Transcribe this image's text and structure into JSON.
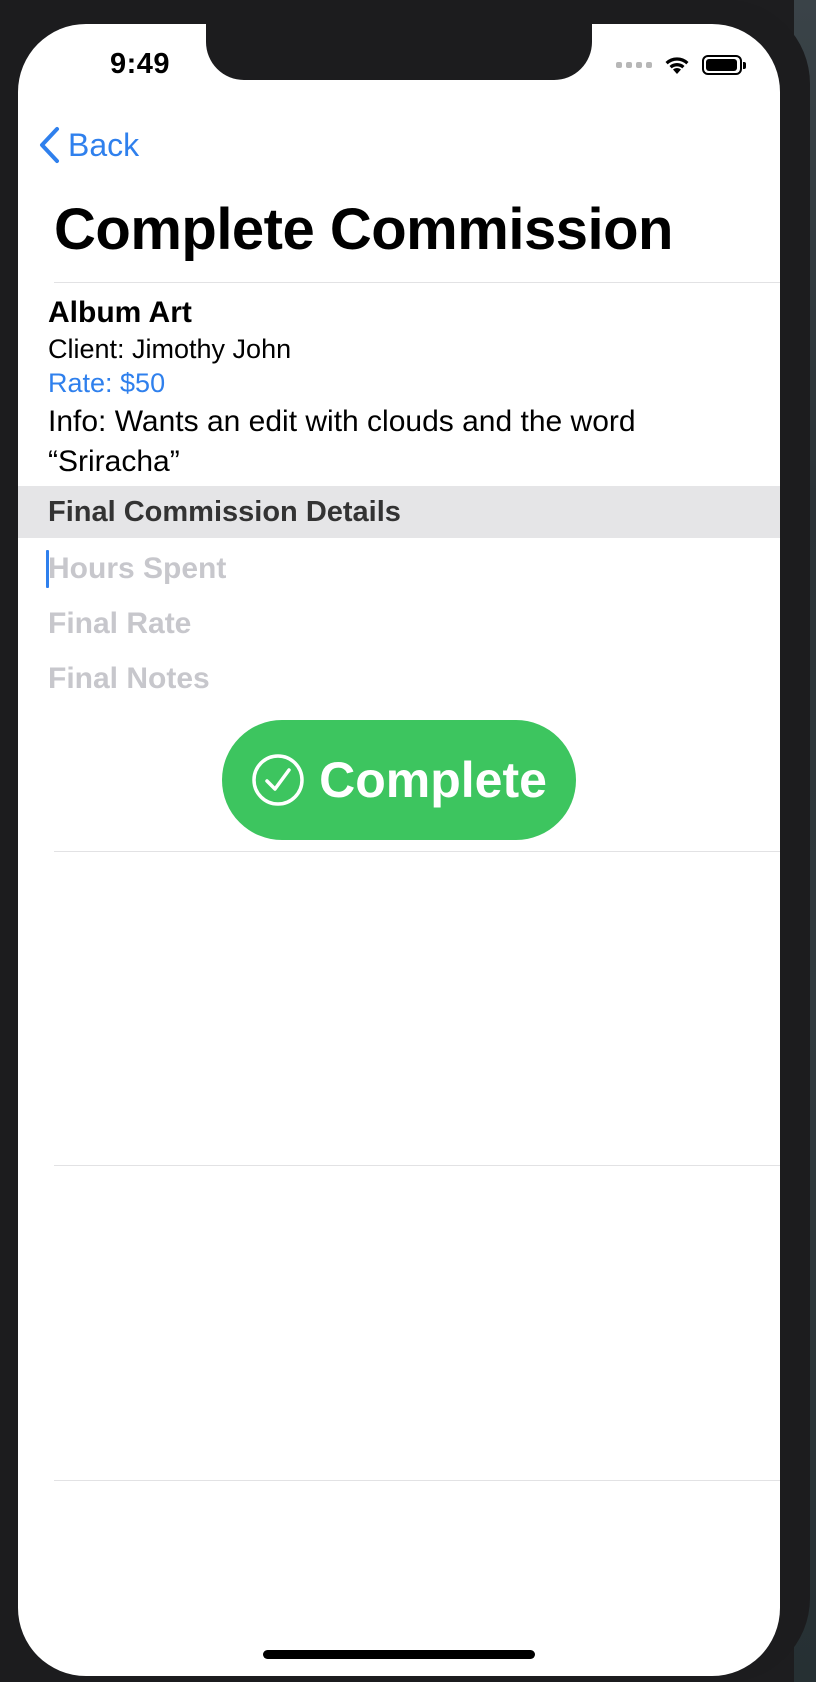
{
  "status_bar": {
    "time": "9:49"
  },
  "nav": {
    "back_label": "Back",
    "title": "Complete Commission"
  },
  "commission": {
    "title": "Album Art",
    "client": "Client: Jimothy John",
    "rate": "Rate: $50",
    "info": "Info: Wants an edit with clouds and the word “Sriracha”"
  },
  "final_section": {
    "header": "Final Commission Details",
    "hours_placeholder": "Hours Spent",
    "hours_value": "",
    "rate_placeholder": "Final Rate",
    "rate_value": "",
    "notes_placeholder": "Final Notes",
    "notes_value": ""
  },
  "actions": {
    "complete_label": "Complete"
  },
  "colors": {
    "accent": "#2f80ed",
    "complete_green": "#3dc55f",
    "section_bg": "#e5e5e7",
    "placeholder": "#c7c7cc"
  },
  "icons": {
    "back": "chevron-left-icon",
    "complete": "checkmark-circle-icon",
    "wifi": "wifi-icon",
    "battery": "battery-icon",
    "signal": "cellular-signal-icon"
  }
}
